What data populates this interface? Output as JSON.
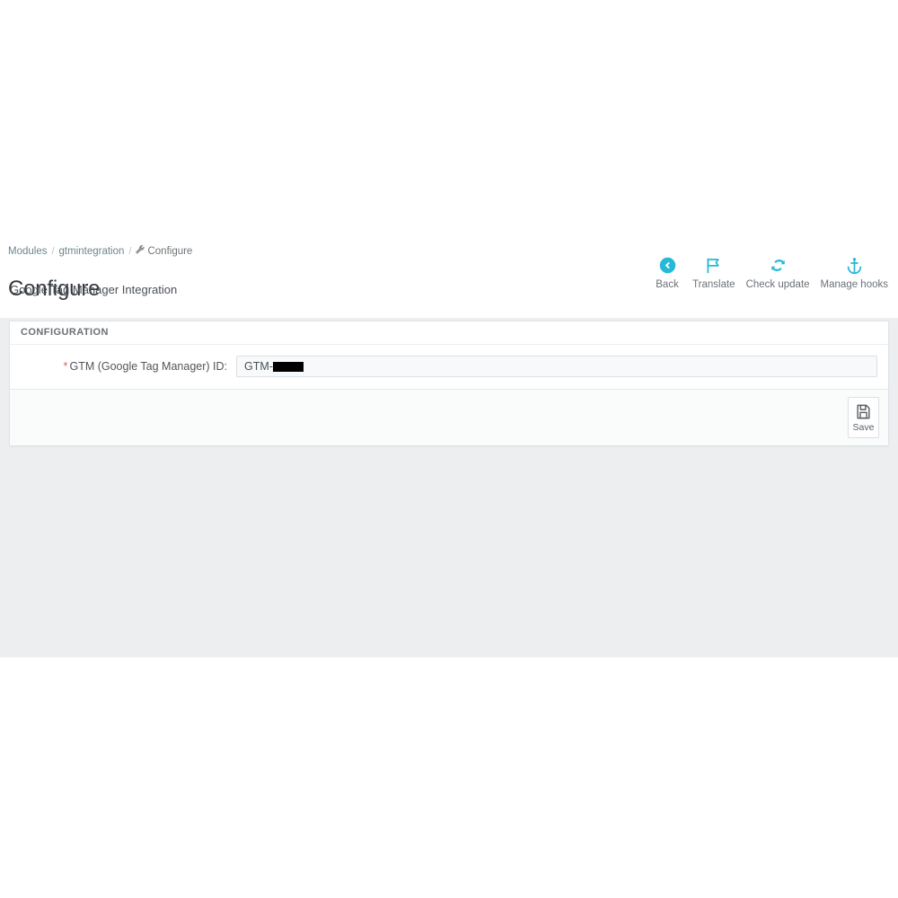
{
  "breadcrumb": {
    "items": [
      {
        "label": "Modules",
        "icon": null
      },
      {
        "label": "gtmintegration",
        "icon": null
      },
      {
        "label": "Configure",
        "icon": "wrench-icon"
      }
    ],
    "separator": "/"
  },
  "header": {
    "title": "Configure",
    "subtitle": "Google Tag Manager Integration"
  },
  "toolbar": {
    "buttons": [
      {
        "label": "Back",
        "icon": "arrow-left-circle-icon"
      },
      {
        "label": "Translate",
        "icon": "flag-icon"
      },
      {
        "label": "Check update",
        "icon": "refresh-icon"
      },
      {
        "label": "Manage hooks",
        "icon": "anchor-icon"
      }
    ]
  },
  "panel": {
    "heading": "CONFIGURATION",
    "form": {
      "field": {
        "label": "GTM (Google Tag Manager) ID:",
        "required_marker": "*",
        "value_prefix": "GTM-",
        "value_redacted": true,
        "placeholder": ""
      }
    },
    "footer": {
      "save_label": "Save",
      "save_icon": "floppy-disk-icon"
    }
  },
  "colors": {
    "accent": "#25b9d7",
    "required": "#ea5b5b",
    "page_background": "#eceef0",
    "panel_background": "#ffffff",
    "footer_background": "#fafbfb",
    "input_background": "#f7f9fa",
    "text_primary": "#363a41",
    "text_muted": "#6c7177",
    "redaction": "#000000"
  }
}
